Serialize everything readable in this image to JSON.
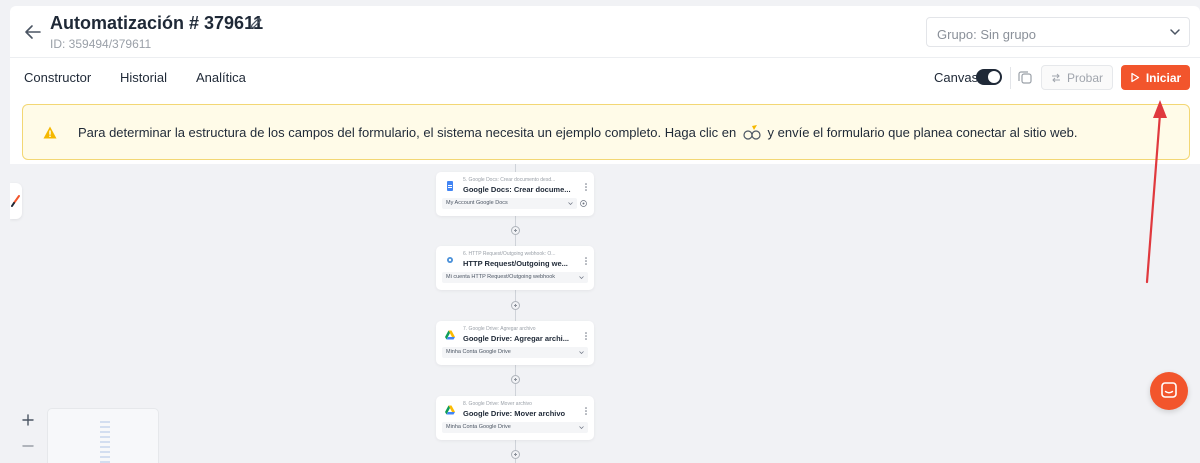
{
  "header": {
    "title": "Automatización # 379611",
    "subtitle": "ID: 359494/379611",
    "group_select": "Grupo: Sin grupo"
  },
  "tabs": [
    {
      "label": "Constructor"
    },
    {
      "label": "Historial"
    },
    {
      "label": "Analítica"
    }
  ],
  "toolbar": {
    "canvas_label": "Canvas",
    "canvas_toggle_on": true,
    "test_label": "Probar",
    "start_label": "Iniciar"
  },
  "banner": {
    "text_before": "Para determinar la estructura de los campos del formulario, el sistema necesita un ejemplo completo. Haga clic en",
    "text_after": "y envíe el formulario que planea conectar al sitio web."
  },
  "flow": {
    "steps": [
      {
        "small": "5. Google Docs: Crear documento desd...",
        "title": "Google Docs: Crear docume...",
        "account": "My Account Google Docs",
        "icon": "google-docs-icon"
      },
      {
        "small": "6. HTTP Request/Outgoing webhook: O...",
        "title": "HTTP Request/Outgoing we...",
        "account": "Mi cuenta HTTP Request/Outgoing webhook",
        "icon": "webhook-icon"
      },
      {
        "small": "7. Google Drive: Agregar archivo",
        "title": "Google Drive: Agregar archi...",
        "account": "Minha Conta Google Drive",
        "icon": "google-drive-icon"
      },
      {
        "small": "8. Google Drive: Mover archivo",
        "title": "Google Drive: Mover archivo",
        "account": "Minha Conta Google Drive",
        "icon": "google-drive-icon"
      }
    ]
  },
  "colors": {
    "accent": "#f2552c",
    "banner_bg": "#fffbe8",
    "banner_border": "#f3d774",
    "annotation_arrow": "#e0393e"
  }
}
